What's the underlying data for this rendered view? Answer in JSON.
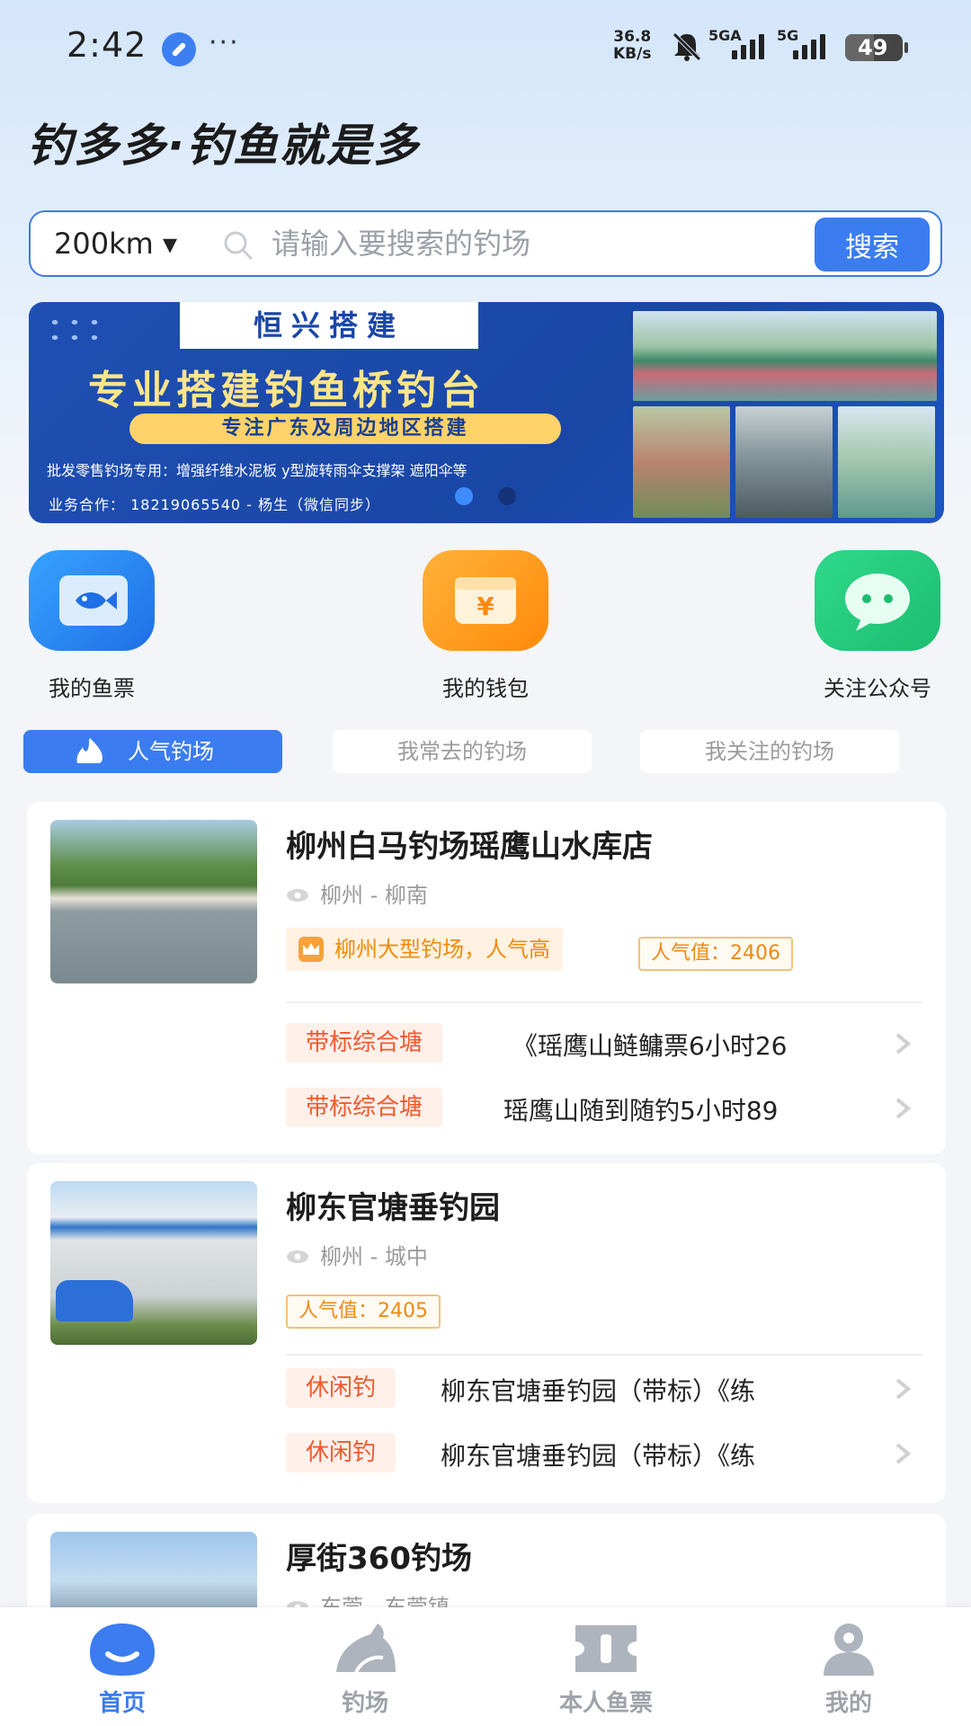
{
  "status_bar": {
    "time": "2:42",
    "menu_dots": "···",
    "net_speed_value": "36.8",
    "net_speed_unit": "KB/s",
    "signal1_label": "5GA",
    "signal2_label": "5G",
    "battery": "49"
  },
  "app": {
    "brand": "钓多多·钓鱼就是多"
  },
  "search": {
    "range": "200km ▾",
    "placeholder": "请输入要搜索的钓场",
    "button": "搜索"
  },
  "banner": {
    "company": "恒兴搭建",
    "headline": "专业搭建钓鱼桥钓台",
    "subline": "专注广东及周边地区搭建",
    "line1": "批发零售钓场专用：增强纤维水泥板 y型旋转雨伞支撑架 遮阳伞等",
    "line2": "业务合作： 18219065540 - 杨生（微信同步）"
  },
  "quick_actions": [
    {
      "label": "我的鱼票",
      "icon": "fish-ticket-icon",
      "color": "#2f7cf2"
    },
    {
      "label": "我的钱包",
      "icon": "wallet-icon",
      "color": "#ff9a1a"
    },
    {
      "label": "关注公众号",
      "icon": "wechat-icon",
      "color": "#22c67a"
    }
  ],
  "tabs": [
    {
      "label": "人气钓场",
      "active": true
    },
    {
      "label": "我常去的钓场",
      "active": false
    },
    {
      "label": "我关注的钓场",
      "active": false
    }
  ],
  "venues": [
    {
      "name": "柳州白马钓场瑶鹰山水库店",
      "location": "柳州 - 柳南",
      "hot_badge": "柳州大型钓场，人气高",
      "popularity": "人气值：2406",
      "tickets": [
        {
          "tag": "带标综合塘",
          "name": "《瑶鹰山鲢鳙票6小时26"
        },
        {
          "tag": "带标综合塘",
          "name": "瑶鹰山随到随钓5小时89"
        }
      ]
    },
    {
      "name": "柳东官塘垂钓园",
      "location": "柳州 - 城中",
      "popularity": "人气值：2405",
      "tickets": [
        {
          "tag": "休闲钓",
          "name": "柳东官塘垂钓园（带标）《练"
        },
        {
          "tag": "休闲钓",
          "name": "柳东官塘垂钓园（带标）《练"
        }
      ]
    },
    {
      "name": "厚街360钓场",
      "location": "东莞 - 东莞镇"
    }
  ],
  "bottom_nav": [
    {
      "label": "首页",
      "active": true
    },
    {
      "label": "钓场",
      "active": false
    },
    {
      "label": "本人鱼票",
      "active": false
    },
    {
      "label": "我的",
      "active": false
    }
  ],
  "colors": {
    "primary": "#3b7cf0",
    "orange": "#f28a0c",
    "red_tag": "#f0592e"
  }
}
